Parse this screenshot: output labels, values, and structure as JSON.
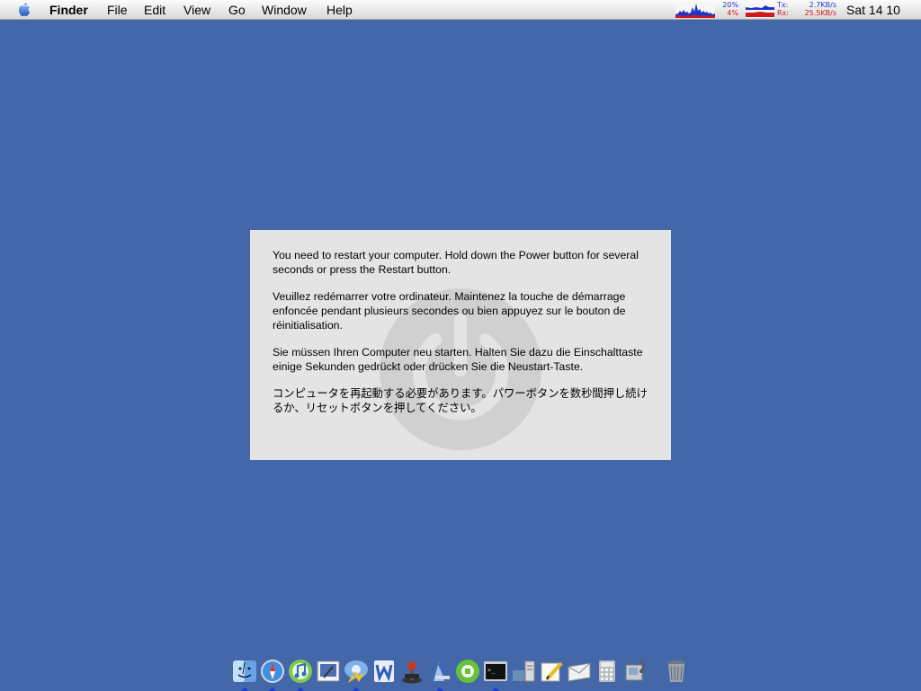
{
  "menubar": {
    "apple_icon": "apple-logo-icon",
    "items": [
      "Finder",
      "File",
      "Edit",
      "View",
      "Go",
      "Window",
      "Help"
    ],
    "cpu": {
      "user": "20%",
      "system": "4%"
    },
    "network": {
      "tx_label": "Tx:",
      "rx_label": "Rx:",
      "tx_value": "2.7KB/s",
      "rx_value": "25.5KB/s"
    },
    "clock": "Sat 14 10"
  },
  "panel": {
    "icon": "power-icon",
    "messages": {
      "en": "You need to restart your computer. Hold down the Power button for several seconds or press the Restart button.",
      "fr": "Veuillez redémarrer votre ordinateur. Maintenez la touche de démarrage enfoncée pendant plusieurs secondes ou bien appuyez sur le bouton de réinitialisation.",
      "de": "Sie müssen Ihren Computer neu starten. Halten Sie dazu die Einschalttaste einige Sekunden gedrückt oder drücken Sie die Neustart-Taste.",
      "ja": "コンピュータを再起動する必要があります。パワーボタンを数秒間押し続けるか、リセットボタンを押してください。"
    }
  },
  "dock": {
    "items": [
      {
        "icon": "finder-icon",
        "running": true
      },
      {
        "icon": "safari-icon",
        "running": true
      },
      {
        "icon": "itunes-icon",
        "running": true
      },
      {
        "icon": "preview-icon",
        "running": false
      },
      {
        "icon": "ichat-icon",
        "running": true
      },
      {
        "icon": "word-icon",
        "running": false
      },
      {
        "icon": "joystick-icon",
        "running": false
      },
      {
        "icon": "xcode-icon",
        "running": true
      },
      {
        "icon": "green-app-icon",
        "running": false
      },
      {
        "icon": "terminal-icon",
        "running": true
      },
      {
        "icon": "server-icon",
        "running": false
      },
      {
        "icon": "text-editor-icon",
        "running": false
      },
      {
        "icon": "mail-icon",
        "running": false
      },
      {
        "icon": "calculator-icon",
        "running": false
      },
      {
        "icon": "system-profiler-icon",
        "running": false
      },
      {
        "icon": "trash-icon",
        "running": false
      }
    ],
    "colors": {
      "running_indicator": "#1a3bd6"
    }
  },
  "colors": {
    "desktop": "#4367a8",
    "panel": "#e4e4e4"
  }
}
